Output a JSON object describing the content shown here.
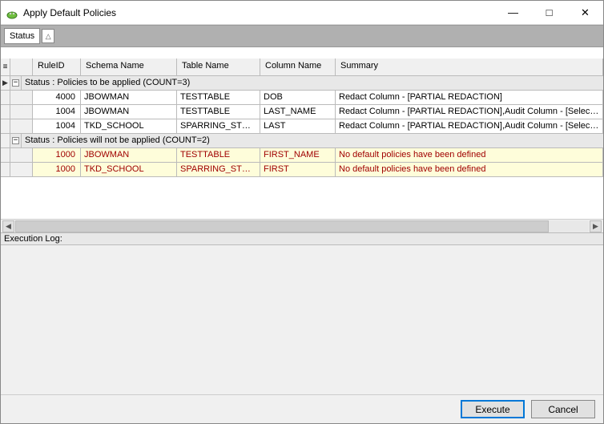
{
  "window": {
    "title": "Apply Default Policies"
  },
  "toolbar": {
    "group_chip": "Status"
  },
  "columns": {
    "rule_id": "RuleID",
    "schema": "Schema Name",
    "table": "Table Name",
    "column": "Column Name",
    "summary": "Summary"
  },
  "groups": [
    {
      "label": "Status : Policies to be applied (COUNT=3)",
      "warn": false,
      "rows": [
        {
          "rule_id": "4000",
          "schema": "JBOWMAN",
          "table": "TESTTABLE",
          "column": "DOB",
          "summary": "Redact Column - [PARTIAL REDACTION]"
        },
        {
          "rule_id": "1004",
          "schema": "JBOWMAN",
          "table": "TESTTABLE",
          "column": "LAST_NAME",
          "summary": "Redact Column - [PARTIAL REDACTION],Audit Column - [Select,Insert,Up"
        },
        {
          "rule_id": "1004",
          "schema": "TKD_SCHOOL",
          "table": "SPARRING_STUD...",
          "column": "LAST",
          "summary": "Redact Column - [PARTIAL REDACTION],Audit Column - [Select,Insert,Up"
        }
      ]
    },
    {
      "label": "Status : Policies will not be applied (COUNT=2)",
      "warn": true,
      "rows": [
        {
          "rule_id": "1000",
          "schema": "JBOWMAN",
          "table": "TESTTABLE",
          "column": "FIRST_NAME",
          "summary": "No default policies have been defined"
        },
        {
          "rule_id": "1000",
          "schema": "TKD_SCHOOL",
          "table": "SPARRING_STUD...",
          "column": "FIRST",
          "summary": "No default policies have been defined"
        }
      ]
    }
  ],
  "log": {
    "label": "Execution Log:"
  },
  "buttons": {
    "execute": "Execute",
    "cancel": "Cancel"
  }
}
